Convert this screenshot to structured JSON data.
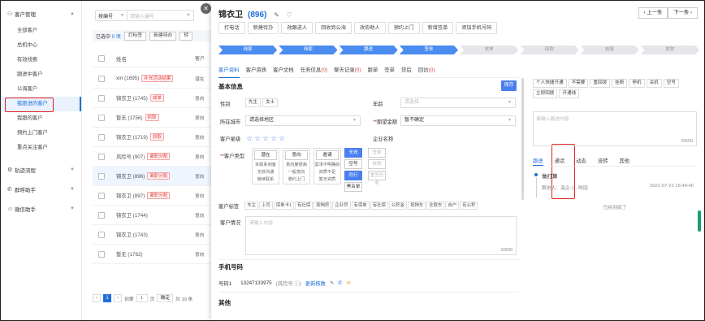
{
  "sidebar": {
    "groups": [
      {
        "label": "客户管理"
      },
      {
        "label": "轨迹流程"
      },
      {
        "label": "群呼助手"
      },
      {
        "label": "微信助手"
      }
    ],
    "items": [
      {
        "label": "全部客户"
      },
      {
        "label": "总机中心"
      },
      {
        "label": "有效线索"
      },
      {
        "label": "跟进中客户"
      },
      {
        "label": "公海客户"
      },
      {
        "label": "我跟进的客户"
      },
      {
        "label": "我跟的客户"
      },
      {
        "label": "预约上门客户"
      },
      {
        "label": "重点关注客户"
      }
    ]
  },
  "list": {
    "search_select": "按编号",
    "search_placeholder": "请输入编号",
    "selected_prefix": "已选中",
    "selected_count": "0 项",
    "toolbar_buttons": [
      "打标签",
      "新建待办",
      "转"
    ],
    "column_header": "姓名",
    "column_header_2": "客户",
    "rows": [
      {
        "name": "xm (1695)",
        "tag": "补充活动结果",
        "suffix": "潜在"
      },
      {
        "name": "锦衣卫 (1745)",
        "tag": "成单",
        "suffix": "意向"
      },
      {
        "name": "暂无 (1756)",
        "tag": "抓取",
        "suffix": "意向"
      },
      {
        "name": "锦衣卫 (1719)",
        "tag": "抓取",
        "suffix": "意向"
      },
      {
        "name": "风险号 (907)",
        "tag": "离职分配",
        "suffix": "意向"
      },
      {
        "name": "锦衣卫 (896)",
        "tag": "离职分配",
        "suffix": "意向"
      },
      {
        "name": "锦衣卫 (897)",
        "tag": "离职分配",
        "suffix": "意向"
      },
      {
        "name": "锦衣卫 (1744)",
        "tag": "",
        "suffix": "意向"
      },
      {
        "name": "锦衣卫 (1743)",
        "tag": "",
        "suffix": "意向"
      },
      {
        "name": "暂无 (1762)",
        "tag": "",
        "suffix": "意向"
      }
    ],
    "pager": {
      "current": "1",
      "goto_label": "到第",
      "page_input": "1",
      "page_unit": "页",
      "confirm": "确定",
      "total": "共 10 条"
    }
  },
  "detail": {
    "title": "锦衣卫",
    "id": "(896)",
    "prev": "上一条",
    "next": "下一条",
    "actions": [
      "打电话",
      "新建待办",
      "改跟进人",
      "回收到公海",
      "改协助人",
      "预约上门",
      "新增签单",
      "添加手机号码"
    ],
    "stages": [
      {
        "label": "线索",
        "state": "done"
      },
      {
        "label": "线索",
        "state": "done"
      },
      {
        "label": "跟进",
        "state": "done"
      },
      {
        "label": "签单",
        "state": "done"
      },
      {
        "label": "收单",
        "state": "todo"
      },
      {
        "label": "回款",
        "state": "todo"
      },
      {
        "label": "结算",
        "state": "todo"
      },
      {
        "label": "放款",
        "state": "todo"
      }
    ],
    "tabs": [
      {
        "label": "客户资料",
        "count": ""
      },
      {
        "label": "客户资质",
        "count": ""
      },
      {
        "label": "客户文档",
        "count": ""
      },
      {
        "label": "任务信息",
        "count": "(0)"
      },
      {
        "label": "聊天记录",
        "count": "(0)"
      },
      {
        "label": "跟单",
        "count": ""
      },
      {
        "label": "签单",
        "count": ""
      },
      {
        "label": "贷后",
        "count": ""
      },
      {
        "label": "回访",
        "count": "(0)"
      }
    ],
    "section_basic": "基本信息",
    "save": "保存",
    "gender_label": "性别",
    "gender_options": [
      "先生",
      "女士"
    ],
    "age_label": "年龄",
    "age_placeholder": "请选择",
    "city_label": "所在城市",
    "city_placeholder": "请选择地区",
    "amount_label": "*期望金额",
    "amount_value": "暂不确定",
    "level_label": "客户星级",
    "stars": "☆☆☆☆☆",
    "company_label": "企业名称",
    "type_label": "*客户类型",
    "type_groups": [
      {
        "head": "潜在",
        "items": [
          "未联系到客",
          "无效沟通",
          "继续联系"
        ],
        "style": "normal"
      },
      {
        "head": "意向",
        "items": [
          "意向度很高",
          "一般意向",
          "邀约上门"
        ],
        "style": "normal"
      },
      {
        "head": "邀请",
        "items": [
          "需求不明确的",
          "资质不足",
          "暂无资质"
        ],
        "style": "normal"
      }
    ],
    "type_col_blue": [
      "无效",
      "空号",
      "同行",
      "黑名单"
    ],
    "type_col_gray": [
      "签单",
      "放款",
      "重签任务"
    ],
    "tags_label": "客户标签",
    "tags": [
      "车主",
      "上司",
      "保单卡1",
      "有社保",
      "按揭房",
      "企业贷",
      "有保单",
      "有社保",
      "公积金",
      "按揭车",
      "全款车",
      "自户",
      "有公积"
    ],
    "status_label": "客户情况",
    "status_placeholder": "请输入内容",
    "status_count": "0/500",
    "section_phone": "手机号码",
    "phone_label": "号码1",
    "phone_number": "13247133975",
    "phone_risk": "(风险号 ⓘ)",
    "phone_update": "更新核数",
    "section_other": "其他"
  },
  "right": {
    "quick_tags": [
      "个人快捷开通",
      "不需要",
      "重回拨",
      "挂断",
      "停机",
      "关机",
      "空号",
      "立即回拨",
      "开通线"
    ],
    "note_placeholder": "请输入跟进内容",
    "note_count": "0/500",
    "tabs": [
      "跟进",
      "通话",
      "动态",
      "流转",
      "其他"
    ],
    "timeline_title": "做打算",
    "timeline_by": "跟进人：高企-1 - 陈园",
    "timeline_time": "2021-07-21 16:44:46",
    "timeline_end": "已经到底了"
  }
}
